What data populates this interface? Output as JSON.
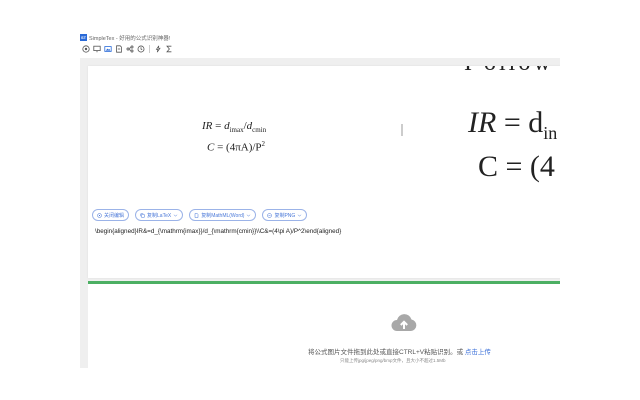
{
  "window": {
    "logo_text": "ST",
    "title": "SimpleTex - 好用的公式识别神器!"
  },
  "toolbar": {
    "icons": [
      "camera-icon",
      "monitor-icon",
      "photo-icon",
      "document-icon",
      "share-icon",
      "history-icon",
      "lightning-icon",
      "sigma-icon"
    ]
  },
  "preview": {
    "line1": {
      "lhs": "IR",
      "sub_max": "imax",
      "sub_min": "cmin"
    },
    "line2": {
      "lhs": "C",
      "mid": " = (4πA)/P",
      "exp": "2"
    },
    "big_line1_lhs": "IR",
    "big_line1_rhs": "= d",
    "big_line1_sub": "in",
    "big_line2": "C = (4",
    "cut_top_text": "I ollow"
  },
  "actions": {
    "close_edit": "关闭编辑",
    "copy_latex": "复制LaTeX",
    "copy_mathml": "复制MathML(Word)",
    "copy_png": "复制PNG"
  },
  "latex_code": "\\begin{aligned}IR&=d_{\\mathrm{imax}}/d_{\\mathrm{cmin}}\\\\C&=(4\\pi A)/P^2\\end{aligned}",
  "upload": {
    "main_text": "将公式图片文件拖到此处或直接CTRL+V粘贴识别。或",
    "link_text": "点击上传",
    "sub_text": "只能上传jpg/jpeg/png/bmp文件，且大小不超过1.5Mb"
  },
  "colors": {
    "accent": "#4a78d8",
    "green_bar": "#4caf63",
    "logo": "#2a6ad8"
  }
}
